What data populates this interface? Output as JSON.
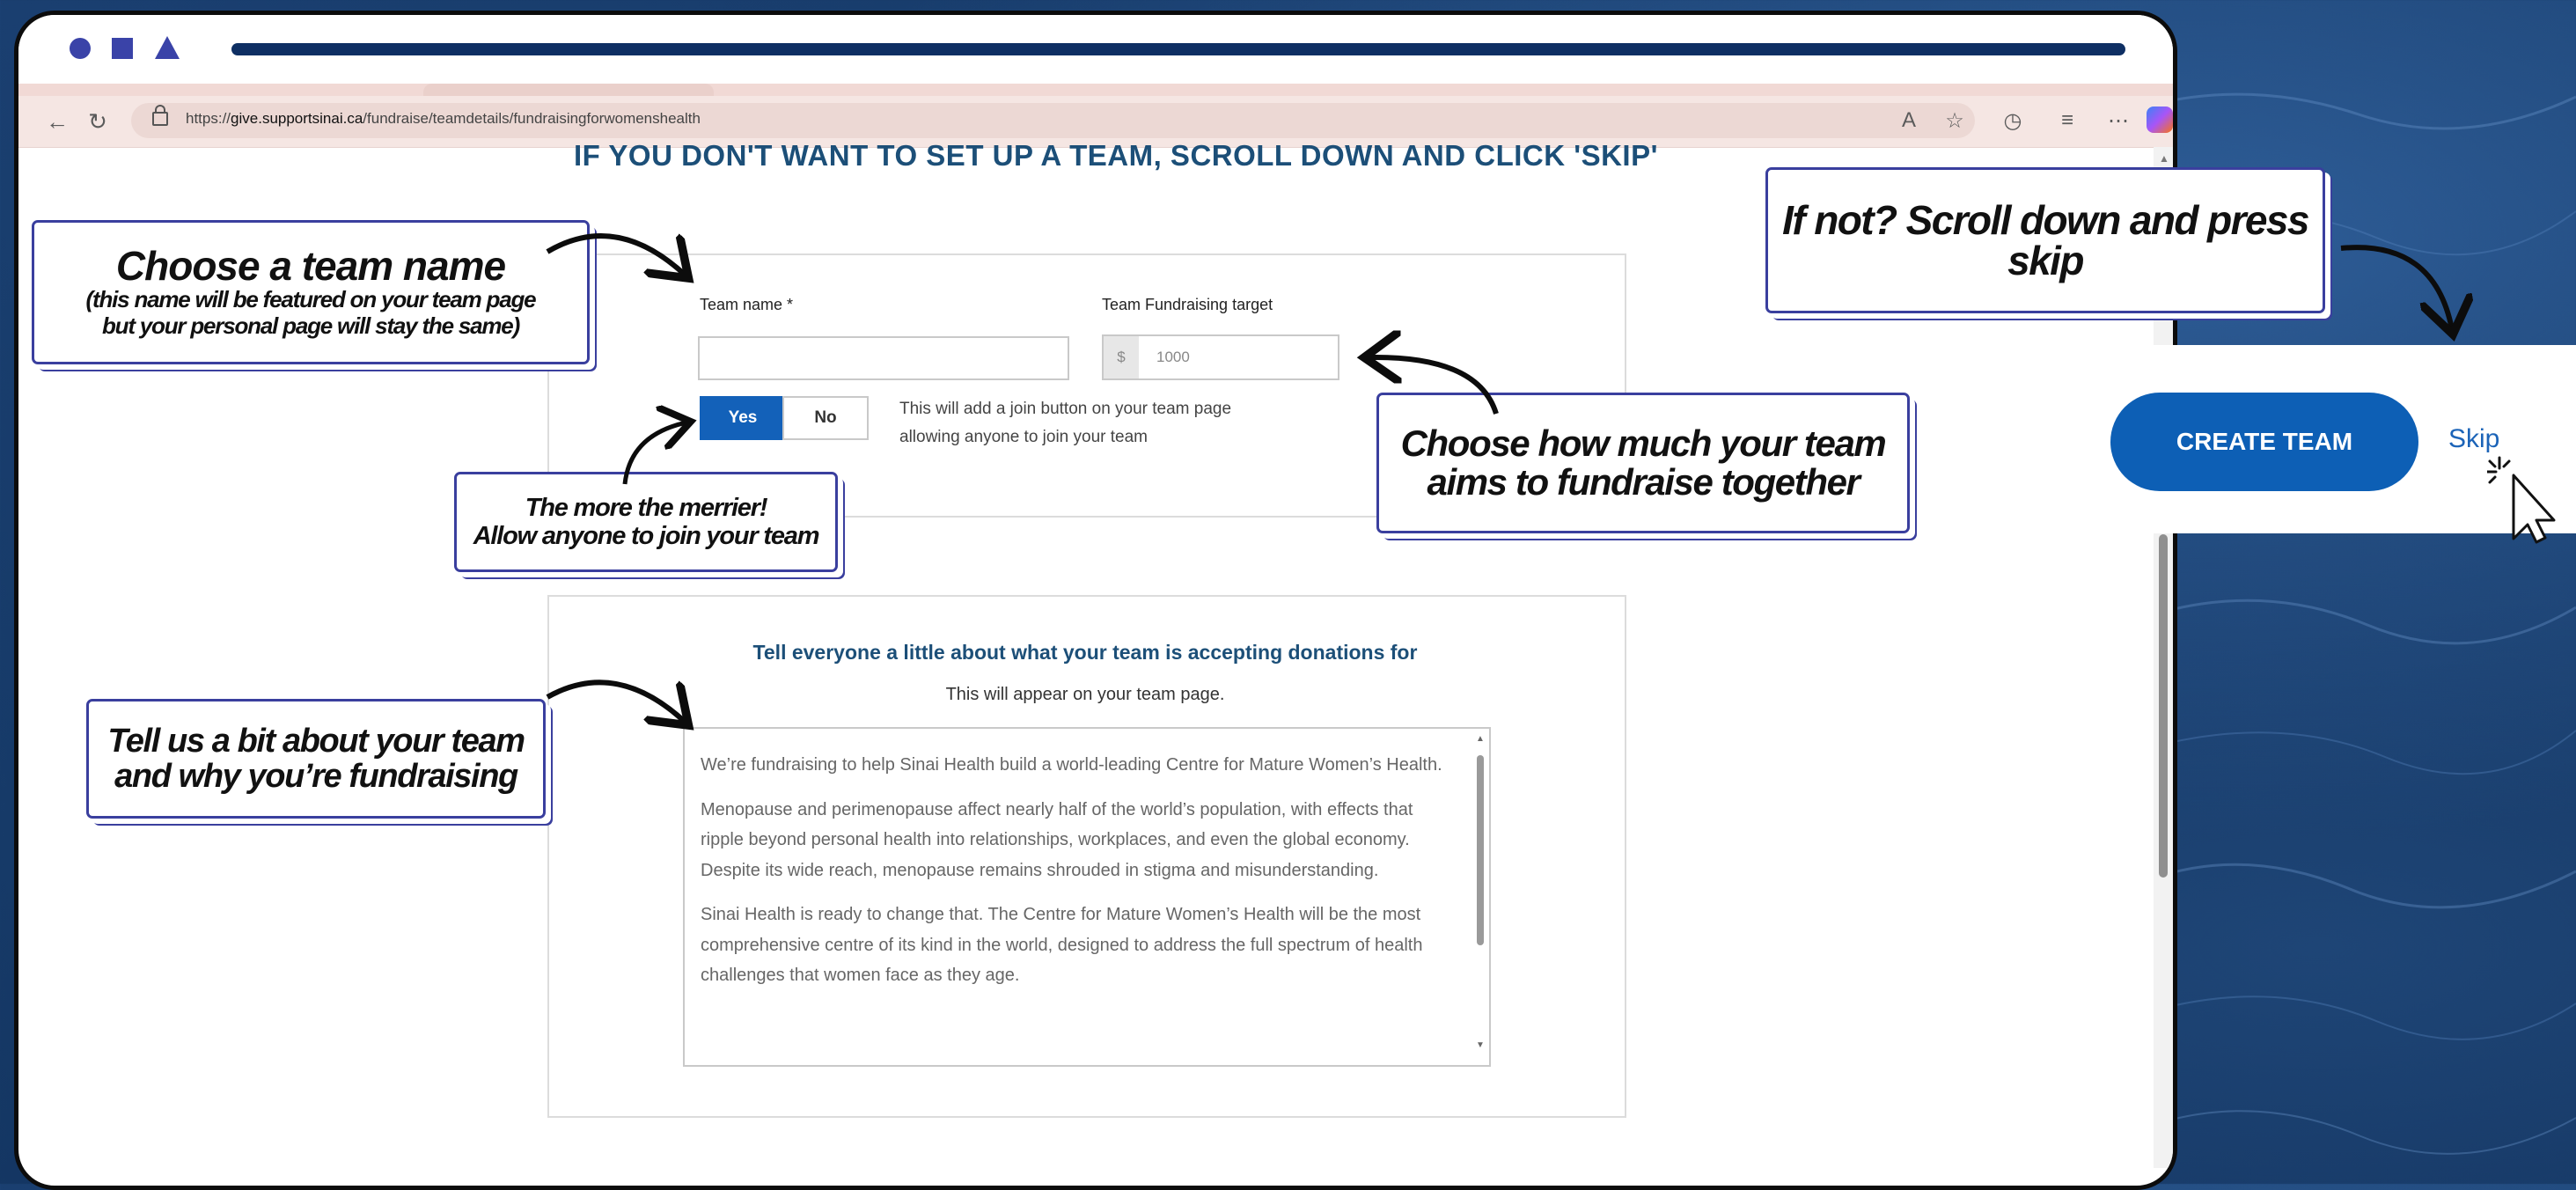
{
  "browser": {
    "url_prefix": "https://",
    "url_domain": "give.supportsinai.ca",
    "url_path": "/fundraise/teamdetails/fundraisingforwomenshealth",
    "icons": [
      "back-icon",
      "refresh-icon",
      "lock-icon",
      "read-aloud-icon",
      "favorite-icon",
      "browser-extension-icon",
      "favorites-list-icon",
      "more-icon",
      "copilot-icon"
    ]
  },
  "page": {
    "instruction": "IF YOU DON'T WANT TO SET UP A TEAM, SCROLL DOWN AND CLICK 'SKIP'",
    "team_name_label": "Team name *",
    "team_name_value": "",
    "target_label": "Team Fundraising target",
    "currency_symbol": "$",
    "target_placeholder": "1000",
    "toggle_yes": "Yes",
    "toggle_no": "No",
    "toggle_selected": "Yes",
    "join_note": "This will add a join button on your team page allowing anyone to join your team",
    "about_heading": "Tell everyone a little about what your team is accepting donations for",
    "about_sub": "This will appear on your team page.",
    "about_paragraphs": [
      "We’re fundraising to help Sinai Health build a world-leading Centre for Mature Women’s Health.",
      "Menopause and perimenopause affect nearly half of the world’s population, with effects that ripple beyond personal health into relationships, workplaces, and even the global economy. Despite its wide reach, menopause remains shrouded in stigma and misunderstanding.",
      "Sinai Health is ready to change that. The Centre for Mature Women’s Health will be the most comprehensive centre of its kind in the world, designed to address the full spectrum of health challenges that women face as they age."
    ]
  },
  "callouts": {
    "team_name_title": "Choose a team name",
    "team_name_line1": "(this name will be featured on your team page",
    "team_name_line2": "but your personal page will stay the same)",
    "join_line1": "The more the merrier!",
    "join_line2": "Allow anyone to join your team",
    "about_line1": "Tell us a bit about your team",
    "about_line2": "and why you’re fundraising",
    "target_line1": "Choose how much your team",
    "target_line2": "aims to fundraise together",
    "skip_line1": "If not? Scroll down and press",
    "skip_line2": "skip"
  },
  "actions": {
    "create_team": "CREATE TEAM",
    "skip": "Skip"
  },
  "colors": {
    "accent_blue": "#1361b9",
    "heading_blue": "#1c4f78",
    "callout_border": "#3a3f9e",
    "background_navy": "#163a68"
  }
}
